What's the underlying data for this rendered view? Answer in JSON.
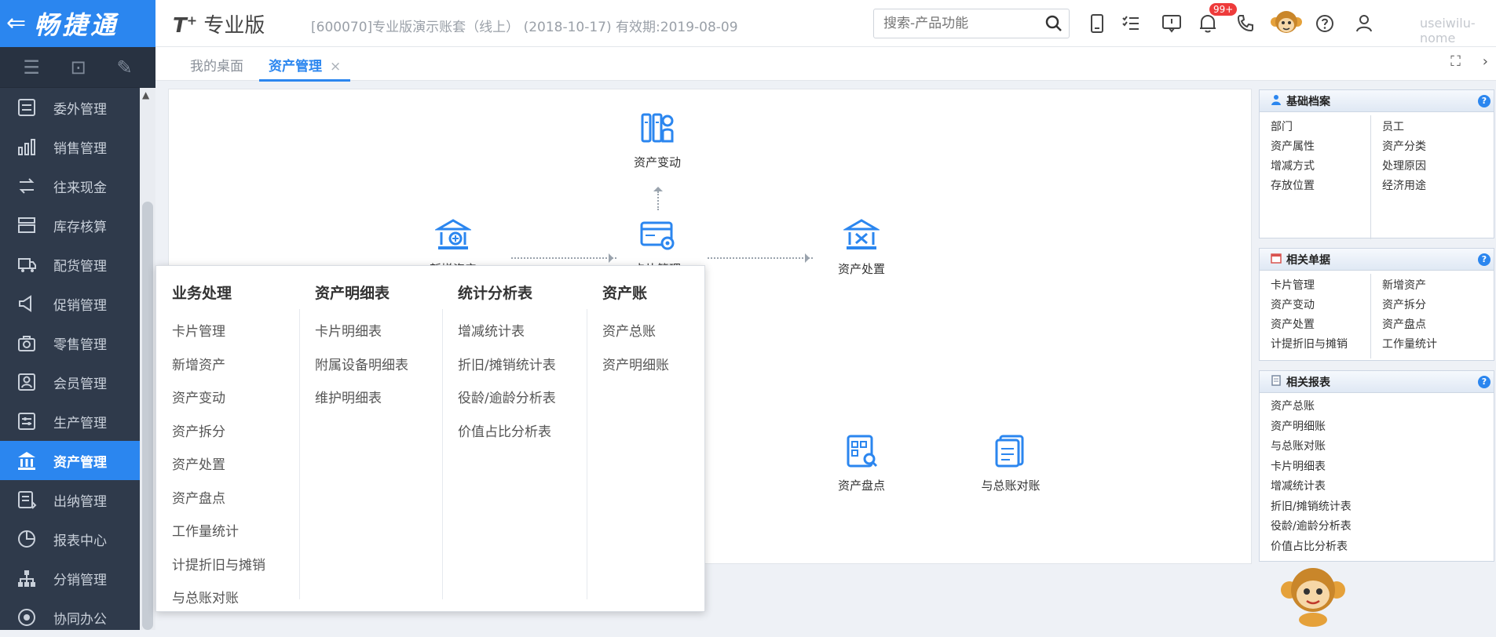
{
  "logo": {
    "back_glyph": "⇐",
    "brand": "畅捷通"
  },
  "side_tools": [
    "menu-icon",
    "collapse-icon",
    "edit-icon"
  ],
  "sidebar": {
    "items": [
      {
        "label": "委外管理",
        "icon": "outsource-icon"
      },
      {
        "label": "销售管理",
        "icon": "sales-chart-icon"
      },
      {
        "label": "往来现金",
        "icon": "cash-transfer-icon"
      },
      {
        "label": "库存核算",
        "icon": "inventory-icon"
      },
      {
        "label": "配货管理",
        "icon": "delivery-icon"
      },
      {
        "label": "促销管理",
        "icon": "promotion-icon"
      },
      {
        "label": "零售管理",
        "icon": "retail-icon"
      },
      {
        "label": "会员管理",
        "icon": "member-icon"
      },
      {
        "label": "生产管理",
        "icon": "production-icon"
      },
      {
        "label": "资产管理",
        "icon": "asset-bank-icon",
        "active": true
      },
      {
        "label": "出纳管理",
        "icon": "cashier-icon"
      },
      {
        "label": "报表中心",
        "icon": "report-pie-icon"
      },
      {
        "label": "分销管理",
        "icon": "distribution-icon"
      },
      {
        "label": "协同办公",
        "icon": "collaboration-icon"
      }
    ]
  },
  "header": {
    "product": "T",
    "product_sup": "+",
    "product_suffix": " 专业版",
    "account": "[600070]专业版演示账套（线上）  (2018-10-17)   有效期:2019-08-09",
    "search_placeholder": "搜索-产品功能",
    "notification_badge": "99+",
    "user_name": "useiwilu-nome"
  },
  "tabs": {
    "desk": "我的桌面",
    "asset": "资产管理",
    "close": "×"
  },
  "flow": {
    "asset_change": "资产变动",
    "add_asset": "新增资产",
    "card_manage": "卡片管理",
    "asset_dispose": "资产处置",
    "asset_count": "资产盘点",
    "ledger_reconcile": "与总账对账"
  },
  "popup": {
    "col1": {
      "title": "业务处理",
      "items": [
        "卡片管理",
        "新增资产",
        "资产变动",
        "资产拆分",
        "资产处置",
        "资产盘点",
        "工作量统计",
        "计提折旧与摊销",
        "与总账对账"
      ]
    },
    "col2": {
      "title": "资产明细表",
      "items": [
        "卡片明细表",
        "附属设备明细表",
        "维护明细表"
      ]
    },
    "col3": {
      "title": "统计分析表",
      "items": [
        "增减统计表",
        "折旧/摊销统计表",
        "役龄/逾龄分析表",
        "价值占比分析表"
      ]
    },
    "col4": {
      "title": "资产账",
      "items": [
        "资产总账",
        "资产明细账"
      ]
    }
  },
  "panels": {
    "basic": {
      "title": "基础档案",
      "left": [
        "部门",
        "资产属性",
        "增减方式",
        "存放位置"
      ],
      "right": [
        "员工",
        "资产分类",
        "处理原因",
        "经济用途"
      ]
    },
    "docs": {
      "title": "相关单据",
      "left": [
        "卡片管理",
        "资产变动",
        "资产处置",
        "计提折旧与摊销"
      ],
      "right": [
        "新增资产",
        "资产拆分",
        "资产盘点",
        "工作量统计"
      ]
    },
    "reports": {
      "title": "相关报表",
      "items": [
        "资产总账",
        "资产明细账",
        "与总账对账",
        "卡片明细表",
        "增减统计表",
        "折旧/摊销统计表",
        "役龄/逾龄分析表",
        "价值占比分析表"
      ]
    },
    "help": "?"
  },
  "colors": {
    "brand_blue": "#2b86ef",
    "sidebar_bg": "#2f3a4b",
    "badge_red": "#ee3b3b"
  }
}
